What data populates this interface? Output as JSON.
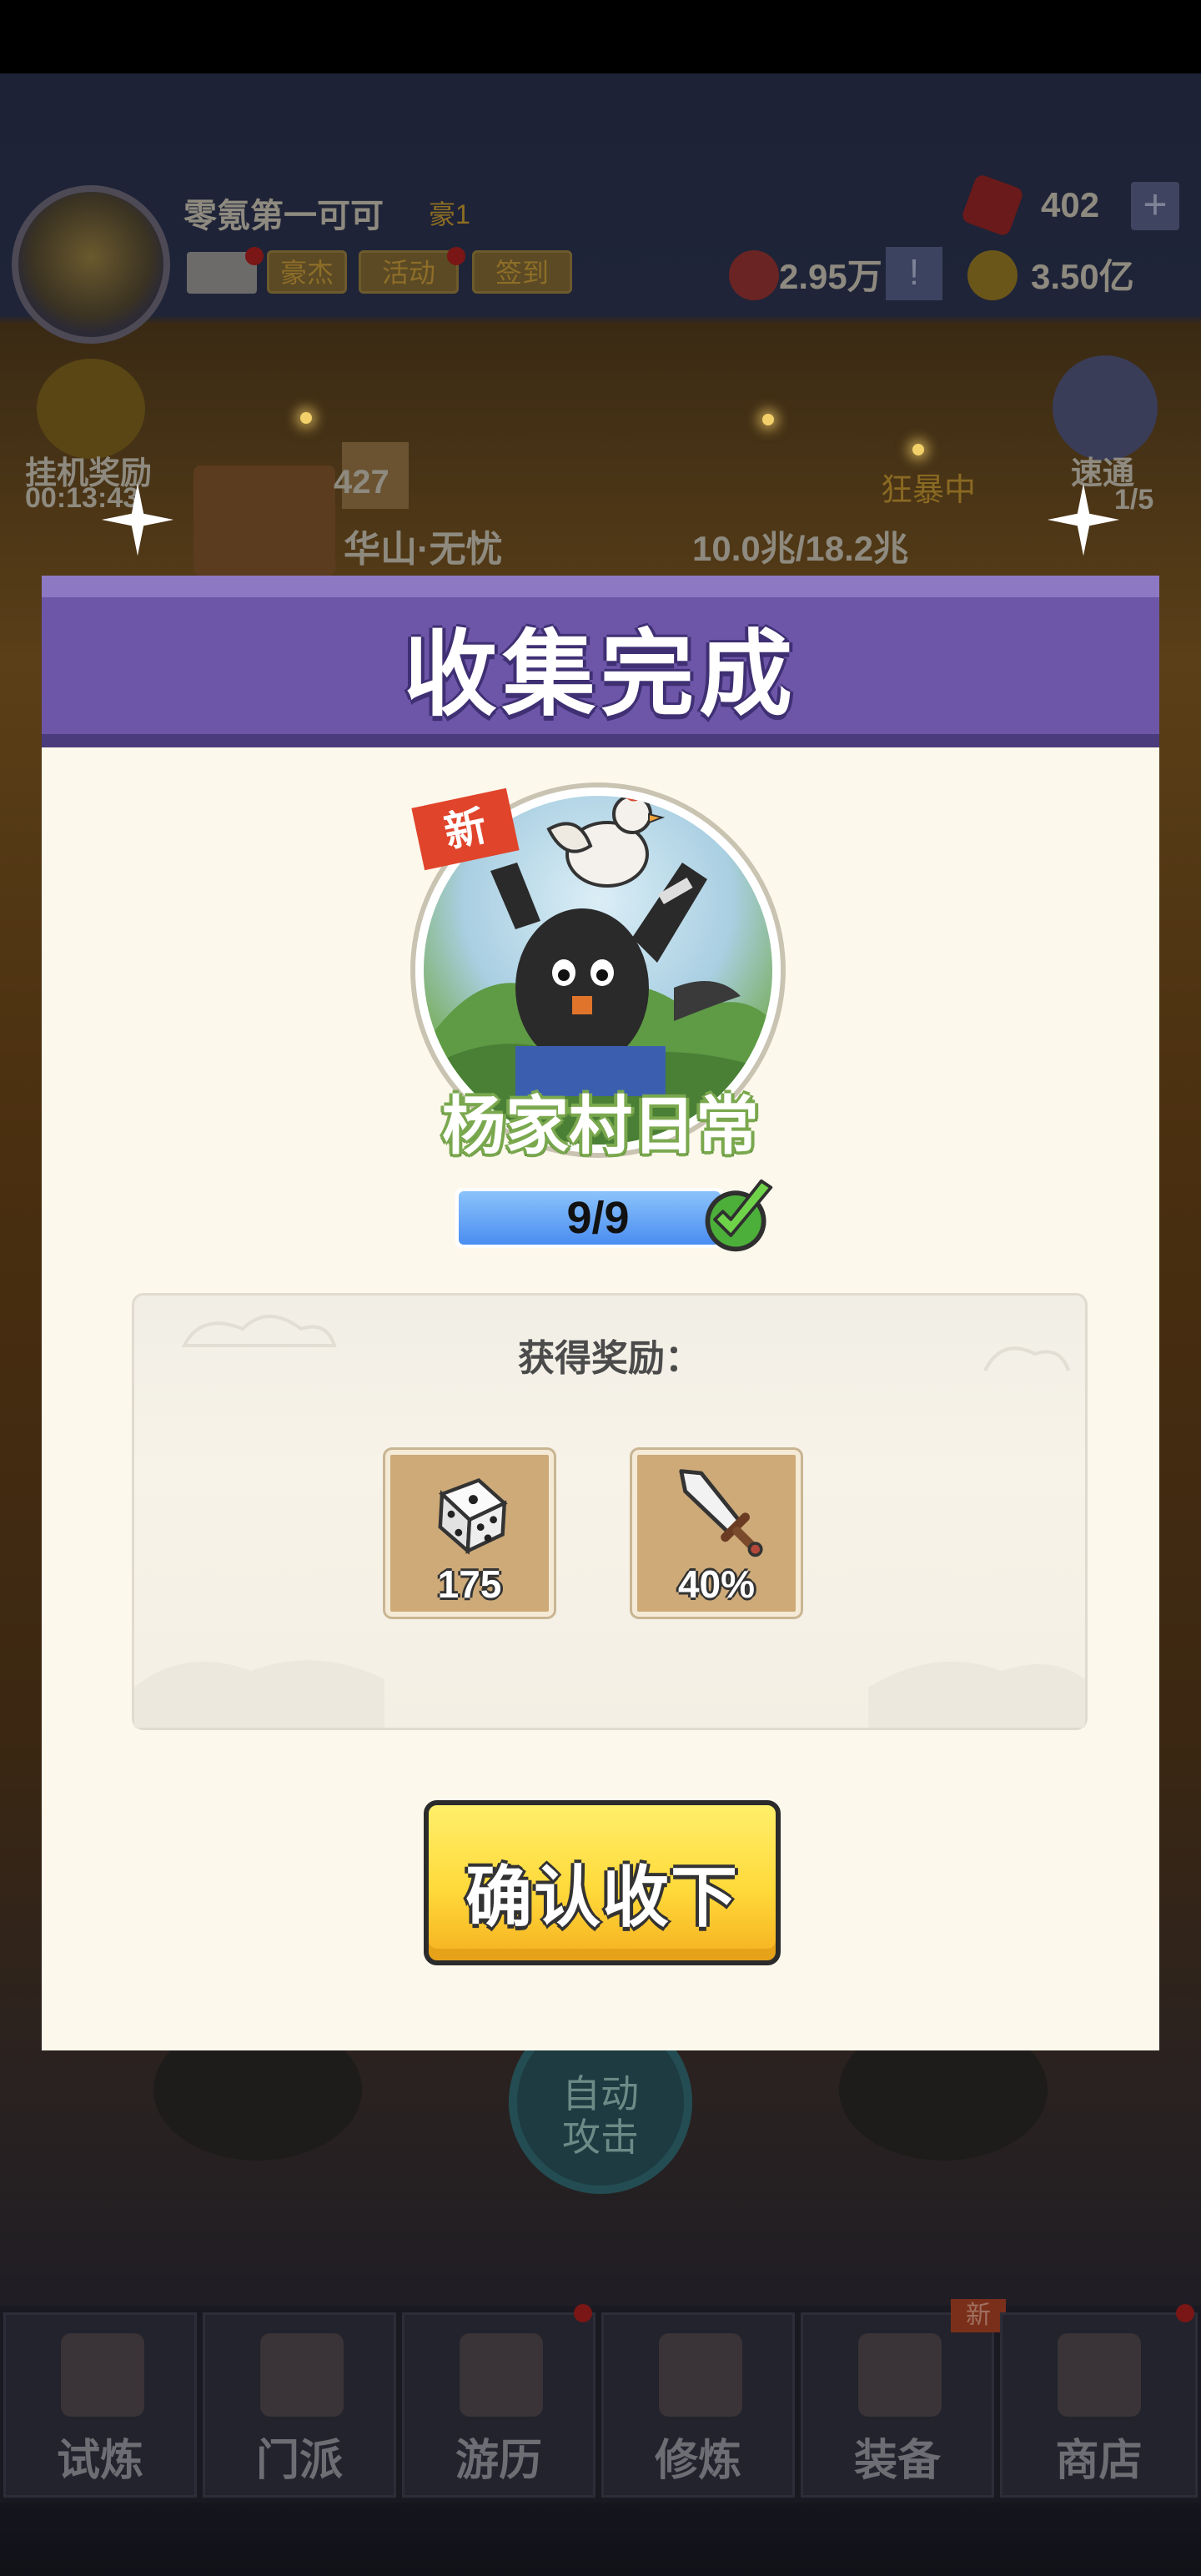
{
  "hud": {
    "player_name": "零氪第一可可",
    "vip": "豪1",
    "tags": [
      "豪杰",
      "活动",
      "签到"
    ],
    "gems": "402",
    "gem_plus": "+",
    "power": "2.95万",
    "power_btn": "!",
    "coins": "3.50亿"
  },
  "side": {
    "afk_label": "挂机奖励",
    "afk_time": "00:13:43",
    "speed_label": "速通",
    "speed_count": "1/5"
  },
  "stage": {
    "number": "427",
    "name": "华山·无忧",
    "hp": "10.0兆/18.2兆",
    "rage": "狂暴中"
  },
  "battle": {
    "auto_attack": "自动攻击"
  },
  "bottom_nav": {
    "items": [
      {
        "label": "试炼",
        "icon": "ninja-icon"
      },
      {
        "label": "门派",
        "icon": "temple-icon"
      },
      {
        "label": "游历",
        "icon": "landscape-icon"
      },
      {
        "label": "修炼",
        "icon": "scroll-icon"
      },
      {
        "label": "装备",
        "icon": "sword-icon"
      },
      {
        "label": "商店",
        "icon": "shop-icon"
      }
    ],
    "new_badge": "新"
  },
  "modal": {
    "title": "收集完成",
    "new_badge": "新",
    "character_name": "杨家村日常",
    "progress": {
      "current": 9,
      "total": 9,
      "text": "9/9",
      "fraction": 1.0
    },
    "reward_title": "获得奖励：",
    "rewards": [
      {
        "icon": "dice-icon",
        "amount": "175"
      },
      {
        "icon": "sword-icon",
        "amount": "40%"
      }
    ],
    "confirm_label": "确认收下"
  },
  "colors": {
    "header": "#6d56a8",
    "panel": "#fdf8ec",
    "button": "#ffd93a",
    "progress": "#4a8df1",
    "check": "#4caf3a"
  }
}
